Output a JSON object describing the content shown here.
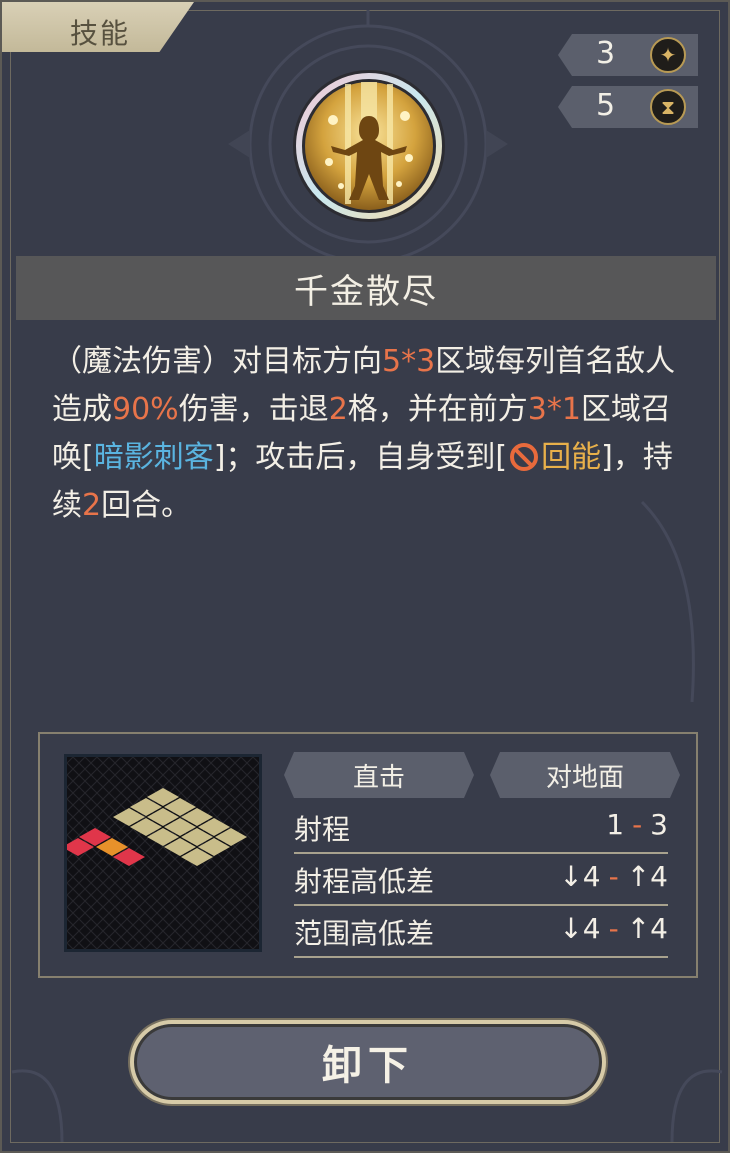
{
  "tab": {
    "label": "技能"
  },
  "stats": [
    {
      "value": "3",
      "icon": "sparkle-icon"
    },
    {
      "value": "5",
      "icon": "hourglass-icon"
    }
  ],
  "skill": {
    "name": "千金散尽",
    "icon": "skill-golden-figure-icon",
    "description": {
      "p1": "（魔法伤害）对目标方向",
      "v1": "5*3",
      "p2": "区域每列首名敌人造成",
      "v2": "90%",
      "p3": "伤害，击退",
      "v3": "2",
      "p4": "格，并在前方",
      "v4": "3*1",
      "p5": "区域召唤[",
      "summon": "暗影刺客",
      "p6": "]；攻击后，自身受到[",
      "debuff": "回能",
      "p7": "]，持续",
      "v5": "2",
      "p8": "回合。"
    }
  },
  "info": {
    "tags": [
      "直击",
      "对地面"
    ],
    "rows": [
      {
        "label": "射程",
        "min": "1",
        "max": "3"
      },
      {
        "label": "射程高低差",
        "min": "↓4",
        "max": "↑4"
      },
      {
        "label": "范围高低差",
        "min": "↓4",
        "max": "↑4"
      }
    ]
  },
  "actions": {
    "unequip_label": "卸下"
  },
  "colors": {
    "number": "#e8744a",
    "summon": "#5ab4e0",
    "debuff": "#e8b04a",
    "accent": "#d9b465"
  }
}
